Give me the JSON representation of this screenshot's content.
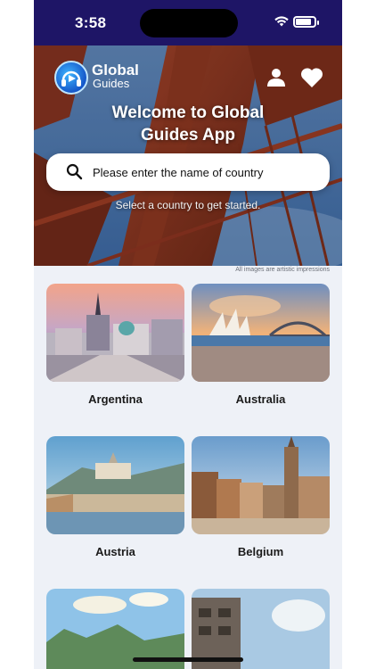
{
  "status_bar": {
    "time": "3:58",
    "battery_level": 0.85
  },
  "header": {
    "logo_title": "Global",
    "logo_subtitle": "Guides",
    "profile_icon": "user-icon",
    "favorites_icon": "heart-icon"
  },
  "hero": {
    "welcome_line1": "Welcome to Global",
    "welcome_line2": "Guides App",
    "search_placeholder": "Please enter the name of country",
    "hint": "Select a country to get started.",
    "disclaimer": "All images are artistic impressions"
  },
  "countries": [
    {
      "name": "Argentina"
    },
    {
      "name": "Australia"
    },
    {
      "name": "Austria"
    },
    {
      "name": "Belgium"
    },
    {
      "name": ""
    },
    {
      "name": ""
    }
  ],
  "colors": {
    "status_bar": "#1e1566",
    "background": "#eef1f7",
    "accent_blue": "#1557c9"
  }
}
